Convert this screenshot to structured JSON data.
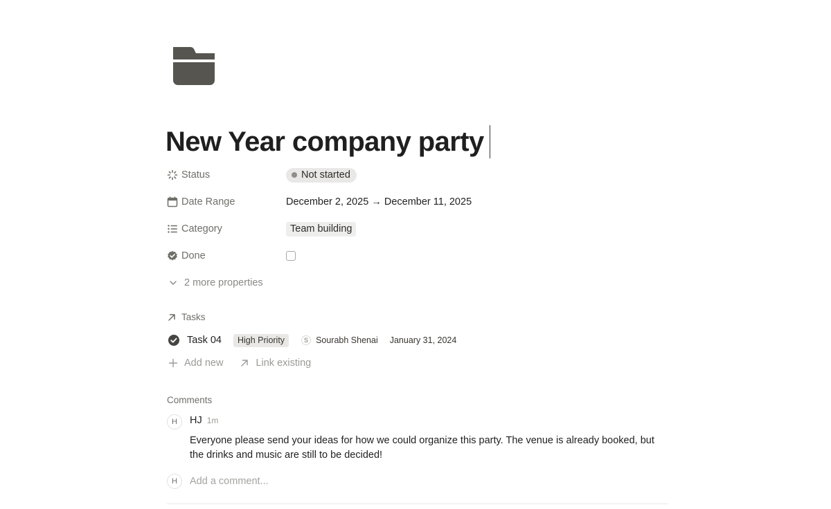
{
  "page": {
    "icon": "folder-icon",
    "title": "New Year company party"
  },
  "properties": [
    {
      "icon": "status-icon",
      "label": "Status",
      "value": "Not started"
    },
    {
      "icon": "calendar-icon",
      "label": "Date Range",
      "value": "December 2, 2025 → December 11, 2025"
    },
    {
      "icon": "list-icon",
      "label": "Category",
      "value": "Team building"
    },
    {
      "icon": "verified-check-icon",
      "label": "Done",
      "checked": false
    }
  ],
  "more_properties": "2 more properties",
  "tasks": {
    "label": "Tasks",
    "items": [
      {
        "name": "Task 04",
        "priority": "High Priority",
        "assignee_initial": "S",
        "assignee": "Sourabh Shenai",
        "date": "January 31, 2024"
      }
    ],
    "add_new": "Add new",
    "link_existing": "Link existing"
  },
  "comments": {
    "label": "Comments",
    "items": [
      {
        "avatar_initial": "H",
        "author": "HJ",
        "time": "1m",
        "text": "Everyone please send your ideas for how we could organize this party. The venue is already booked, but the drinks and music are still to be decided!"
      }
    ],
    "input_avatar_initial": "H",
    "placeholder": "Add a comment..."
  },
  "colors": {
    "text": "#37352f",
    "muted": "#6f6e69",
    "pill_bg": "#e9e8e6",
    "icon_fill": "#57554f"
  }
}
